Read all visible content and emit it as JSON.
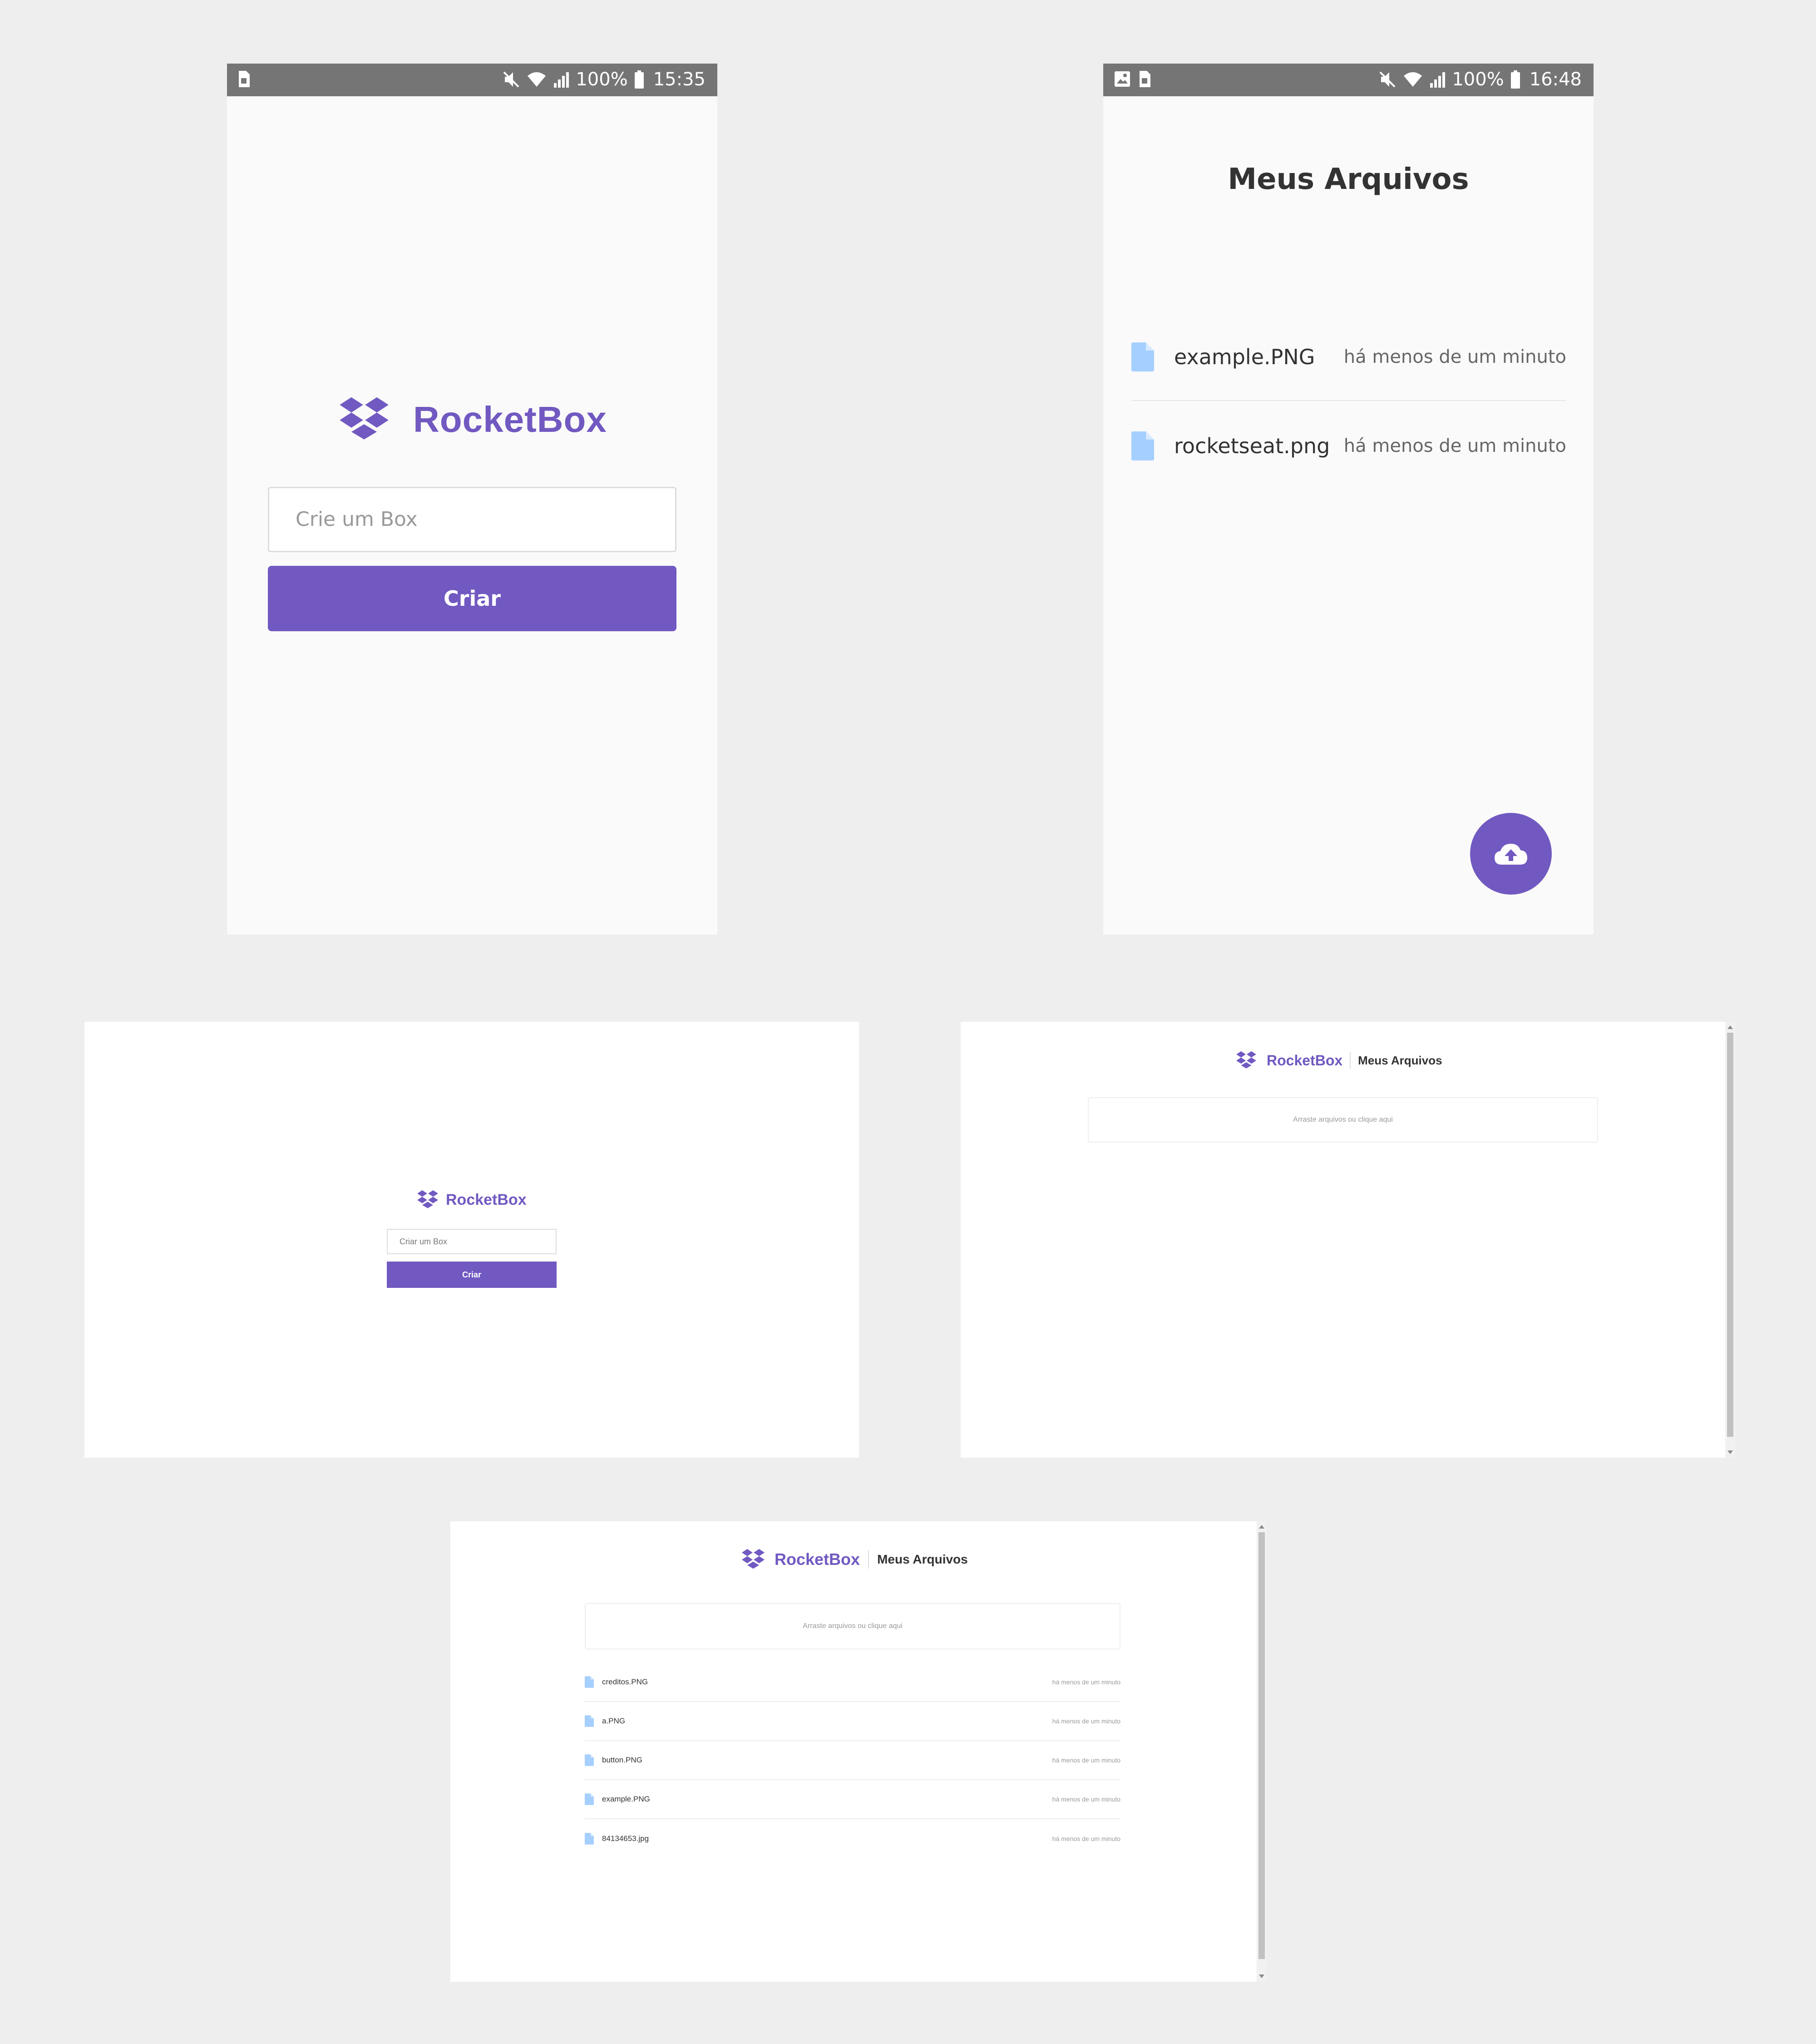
{
  "brand": {
    "name": "RocketBox",
    "color": "#7159c1"
  },
  "mobile_login": {
    "status_bar": {
      "battery": "100%",
      "time": "15:35"
    },
    "input_placeholder": "Crie um Box",
    "button_label": "Criar"
  },
  "mobile_box": {
    "status_bar": {
      "battery": "100%",
      "time": "16:48"
    },
    "title": "Meus Arquivos",
    "files": [
      {
        "name": "example.PNG",
        "date": "há menos de um minuto"
      },
      {
        "name": "rocketseat.png",
        "date": "há menos de um minuto"
      }
    ],
    "fab_icon": "cloud-upload-icon"
  },
  "web_login": {
    "input_placeholder": "Criar um Box",
    "button_label": "Criar"
  },
  "web_box_empty": {
    "title": "Meus Arquivos",
    "dropzone_text": "Arraste arquivos ou clique aqui"
  },
  "web_box_files": {
    "title": "Meus Arquivos",
    "dropzone_text": "Arraste arquivos ou clique aqui",
    "files": [
      {
        "name": "creditos.PNG",
        "date": "há menos de um minuto"
      },
      {
        "name": "a.PNG",
        "date": "há menos de um minuto"
      },
      {
        "name": "button.PNG",
        "date": "há menos de um minuto"
      },
      {
        "name": "example.PNG",
        "date": "há menos de um minuto"
      },
      {
        "name": "84134653.jpg",
        "date": "há menos de um minuto"
      }
    ]
  },
  "colors": {
    "accent": "#7159c1",
    "file_icon": "#a5cfff",
    "status_bar": "#757575",
    "background": "#eeeeee"
  }
}
